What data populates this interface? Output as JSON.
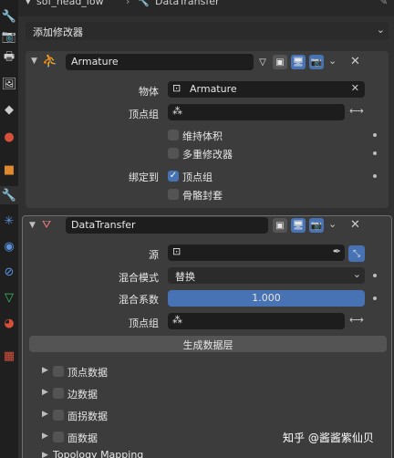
{
  "header": {
    "object_name": "sof_head_low",
    "modifier_context": "DataTransfer",
    "add_modifier_label": "添加修改器"
  },
  "armature_mod": {
    "name": "Armature",
    "object_label": "物体",
    "object_value": "Armature",
    "vgroup_label": "顶点组",
    "vgroup_value": "",
    "preserve_volume_label": "维持体积",
    "multi_modifier_label": "多重修改器",
    "bind_to_label": "绑定到",
    "vertex_groups_label": "顶点组",
    "bone_envelopes_label": "骨骼封套"
  },
  "datatransfer_mod": {
    "name": "DataTransfer",
    "source_label": "源",
    "source_value": "",
    "mix_mode_label": "混合模式",
    "mix_mode_value": "替换",
    "mix_factor_label": "混合系数",
    "mix_factor_value": "1.000",
    "vgroup_label": "顶点组",
    "generate_layers_label": "生成数据层",
    "sections": [
      "顶点数据",
      "边数据",
      "面拐数据",
      "面数据",
      "Topology Mapping"
    ]
  },
  "watermark": "知乎 @酱酱紫仙贝",
  "colors": {
    "accent": "#4772b3",
    "panel": "#3c3c3c",
    "field": "#1d1d1d",
    "background": "#303030"
  }
}
